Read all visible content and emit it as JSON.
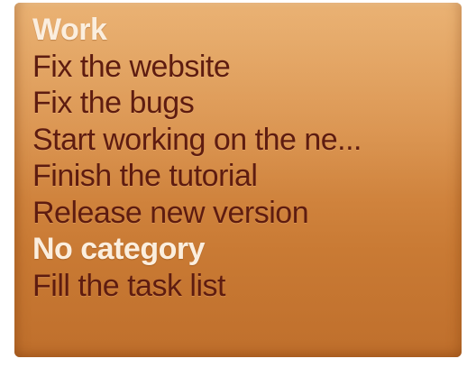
{
  "task_list": {
    "groups": [
      {
        "category": "Work",
        "tasks": [
          "Fix the website",
          "Fix the bugs",
          "Start working on the ne...",
          "Finish the tutorial",
          "Release new version"
        ]
      },
      {
        "category": "No category",
        "tasks": [
          "Fill the task list"
        ]
      }
    ]
  },
  "colors": {
    "panel_top": "#e4a25c",
    "panel_bottom": "#bf6f2c",
    "category_text": "#fbeede",
    "task_text": "#5e1c10"
  }
}
